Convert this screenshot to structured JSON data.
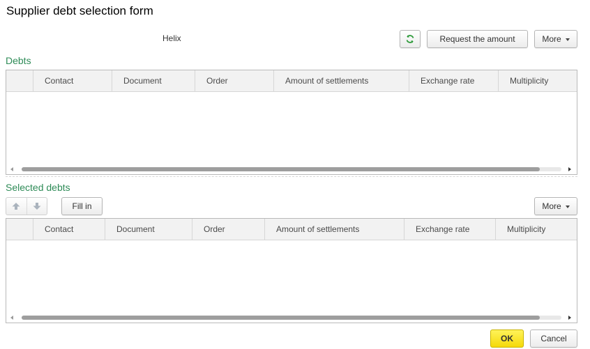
{
  "window": {
    "title": "Supplier debt selection form"
  },
  "header": {
    "organization": "Helix",
    "refresh_icon": "refresh-icon",
    "request_amount_label": "Request the amount",
    "more_label": "More"
  },
  "debts": {
    "section_title": "Debts",
    "columns": [
      "Contact",
      "Document",
      "Order",
      "Amount of settlements",
      "Exchange rate",
      "Multiplicity"
    ],
    "rows": [],
    "scroll_fraction": 0.96
  },
  "selected": {
    "section_title": "Selected debts",
    "move_up_icon": "arrow-up-icon",
    "move_down_icon": "arrow-down-icon",
    "fill_in_label": "Fill in",
    "more_label": "More",
    "columns": [
      "Contact",
      "Document",
      "Order",
      "Amount of settlements",
      "Exchange rate",
      "Multiplicity"
    ],
    "rows": [],
    "scroll_fraction": 0.96
  },
  "footer": {
    "ok_label": "OK",
    "cancel_label": "Cancel"
  },
  "colors": {
    "accent_green": "#2e8b57",
    "ok_yellow": "#f5d90a"
  }
}
